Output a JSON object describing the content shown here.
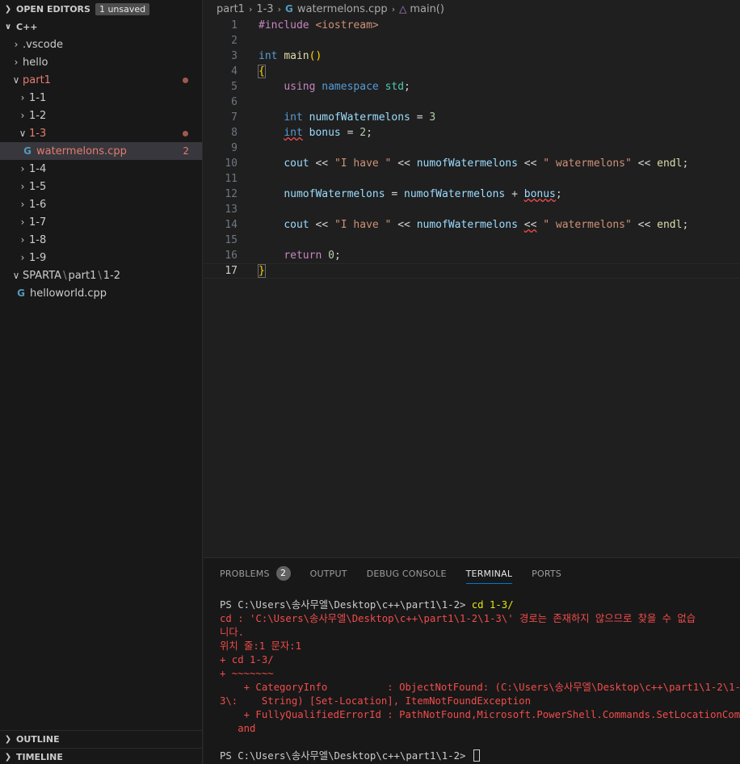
{
  "sidebar": {
    "open_editors": {
      "title": "OPEN EDITORS",
      "badge": "1 unsaved"
    },
    "workspace": {
      "title": "C++"
    },
    "tree": {
      "vscode": ".vscode",
      "hello": "hello",
      "part1": "part1",
      "f1_1": "1-1",
      "f1_2": "1-2",
      "f1_3": "1-3",
      "watermelons": "watermelons.cpp",
      "watermelons_problems": "2",
      "f1_4": "1-4",
      "f1_5": "1-5",
      "f1_6": "1-6",
      "f1_7": "1-7",
      "f1_8": "1-8",
      "f1_9": "1-9",
      "sparta": {
        "a": "SPARTA",
        "b": "part1",
        "c": "1-2"
      },
      "helloworld": "helloworld.cpp"
    },
    "outline": "OUTLINE",
    "timeline": "TIMELINE"
  },
  "breadcrumb": {
    "part1": "part1",
    "folder": "1-3",
    "file": "watermelons.cpp",
    "symbol": "main()"
  },
  "editor": {
    "line_numbers": [
      "1",
      "2",
      "3",
      "4",
      "5",
      "6",
      "7",
      "8",
      "9",
      "10",
      "11",
      "12",
      "13",
      "14",
      "15",
      "16",
      "17"
    ],
    "current_line": "17",
    "tokens": {
      "include": "#include",
      "iostream": "<iostream>",
      "int": "int",
      "main": "main",
      "parens": "()",
      "open_brace": "{",
      "close_brace": "}",
      "using": "using",
      "namespace": "namespace",
      "std": "std",
      "semi": ";",
      "numofWatermelons": "numofWatermelons",
      "bonus": "bonus",
      "eq": "=",
      "three": "3",
      "two": "2",
      "zero": "0",
      "cout": "cout",
      "shl": "<<",
      "str_have": "\"I have \"",
      "str_water": "\" watermelons\"",
      "endl": "endl",
      "plus": "+",
      "return": "return"
    }
  },
  "panel": {
    "tabs": {
      "problems": "PROBLEMS",
      "problems_count": "2",
      "output": "OUTPUT",
      "debug": "DEBUG CONSOLE",
      "terminal": "TERMINAL",
      "ports": "PORTS"
    },
    "terminal": {
      "prompt1": "PS C:\\Users\\송사무엘\\Desktop\\c++\\part1\\1-2> ",
      "cmd1": "cd 1-3/",
      "err1": "cd : 'C:\\Users\\송사무엘\\Desktop\\c++\\part1\\1-2\\1-3\\' 경로는 존재하지 않으므로 찾을 수 없습",
      "err2": "니다.",
      "err3": "위치 줄:1 문자:1",
      "err4": "+ cd 1-3/",
      "err5": "+ ~~~~~~~",
      "err6": "    + CategoryInfo          : ObjectNotFound: (C:\\Users\\송사무엘\\Desktop\\c++\\part1\\1-2\\1-",
      "err7": "3\\:    String) [Set-Location], ItemNotFoundException",
      "err8": "    + FullyQualifiedErrorId : PathNotFound,Microsoft.PowerShell.Commands.SetLocationComm",
      "err9": "   and",
      "prompt2": "PS C:\\Users\\송사무엘\\Desktop\\c++\\part1\\1-2> "
    }
  },
  "colors": {
    "keyword": "#569cd6",
    "function": "#dcdcaa",
    "variable": "#9cdcfe",
    "string": "#ce9178",
    "number": "#b5cea8",
    "namespace": "#4ec9b0",
    "error": "#f14c4c",
    "modified": "#e57b6f"
  }
}
